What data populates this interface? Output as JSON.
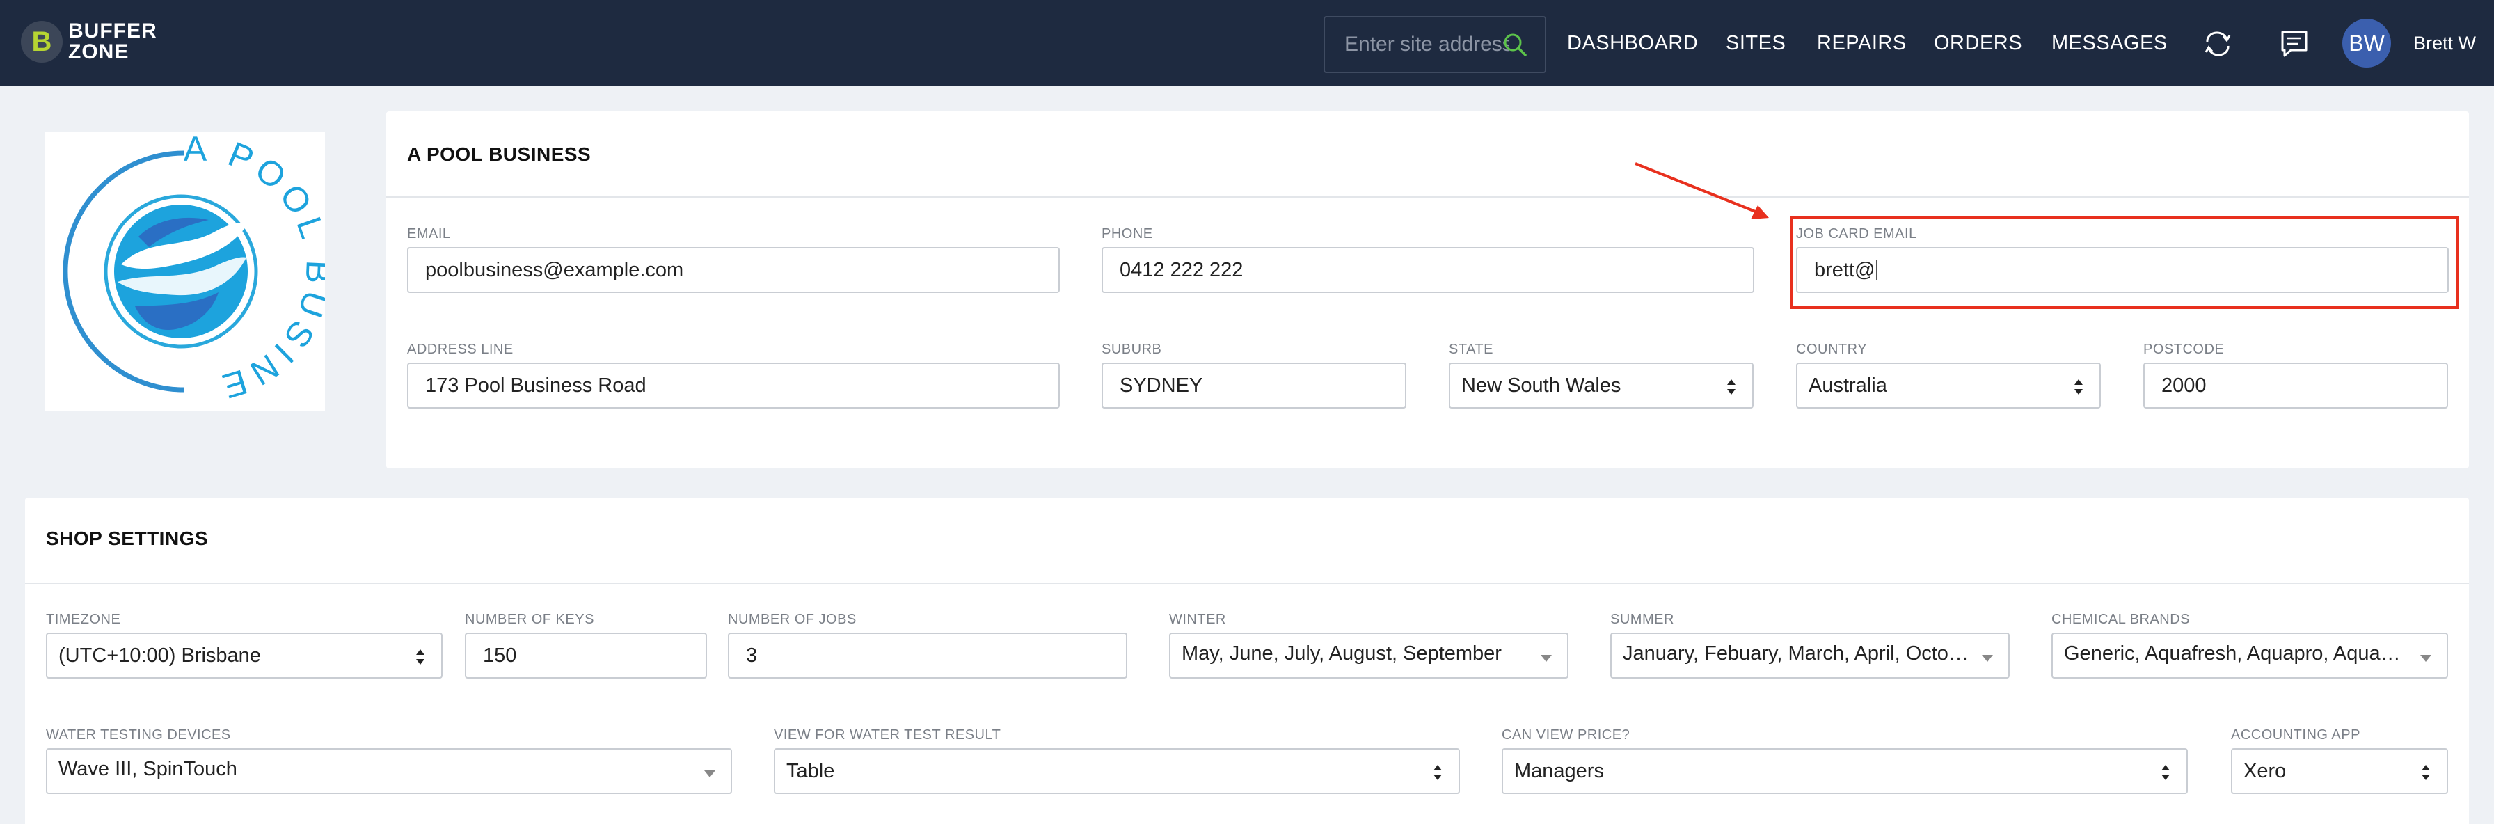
{
  "brand": {
    "letter": "B",
    "line1": "BUFFER",
    "line2": "ZONE"
  },
  "search": {
    "placeholder": "Enter site address"
  },
  "nav": {
    "dashboard": "DASHBOARD",
    "sites": "SITES",
    "repairs": "REPAIRS",
    "orders": "ORDERS",
    "messages": "MESSAGES"
  },
  "icons": {
    "sync": "sync-icon",
    "chat": "chat-icon",
    "search": "search-icon"
  },
  "user": {
    "initials": "BW",
    "name": "Brett W"
  },
  "logo": {
    "text": "A POOL BUSINESS"
  },
  "business": {
    "title": "A POOL BUSINESS",
    "email_label": "EMAIL",
    "email_value": "poolbusiness@example.com",
    "phone_label": "PHONE",
    "phone_value": "0412 222 222",
    "job_card_email_label": "JOB CARD EMAIL",
    "job_card_email_value": "brett@",
    "address_label": "ADDRESS LINE",
    "address_value": "173 Pool Business Road",
    "suburb_label": "SUBURB",
    "suburb_value": "SYDNEY",
    "state_label": "STATE",
    "state_value": "New South Wales",
    "country_label": "COUNTRY",
    "country_value": "Australia",
    "postcode_label": "POSTCODE",
    "postcode_value": "2000"
  },
  "shop": {
    "title": "SHOP SETTINGS",
    "timezone_label": "TIMEZONE",
    "timezone_value": "(UTC+10:00) Brisbane",
    "keys_label": "NUMBER OF KEYS",
    "keys_value": "150",
    "jobs_label": "NUMBER OF JOBS",
    "jobs_value": "3",
    "winter_label": "WINTER",
    "winter_value": "May, June, July, August, September",
    "summer_label": "SUMMER",
    "summer_value": "January, Febuary, March, April, October, November, December",
    "chem_label": "CHEMICAL BRANDS",
    "chem_value": "Generic, Aquafresh, Aquapro, Aquaspa, Bioguard",
    "devices_label": "WATER TESTING DEVICES",
    "devices_value": "Wave III, SpinTouch",
    "view_label": "VIEW FOR WATER TEST RESULT",
    "view_value": "Table",
    "price_label": "CAN VIEW PRICE?",
    "price_value": "Managers",
    "accounting_label": "ACCOUNTING APP",
    "accounting_value": "Xero"
  },
  "colors": {
    "nav_bg": "#1e2a40",
    "highlight": "#e8301e",
    "logo_blue": "#29a8dc",
    "avatar": "#3b5fae"
  }
}
